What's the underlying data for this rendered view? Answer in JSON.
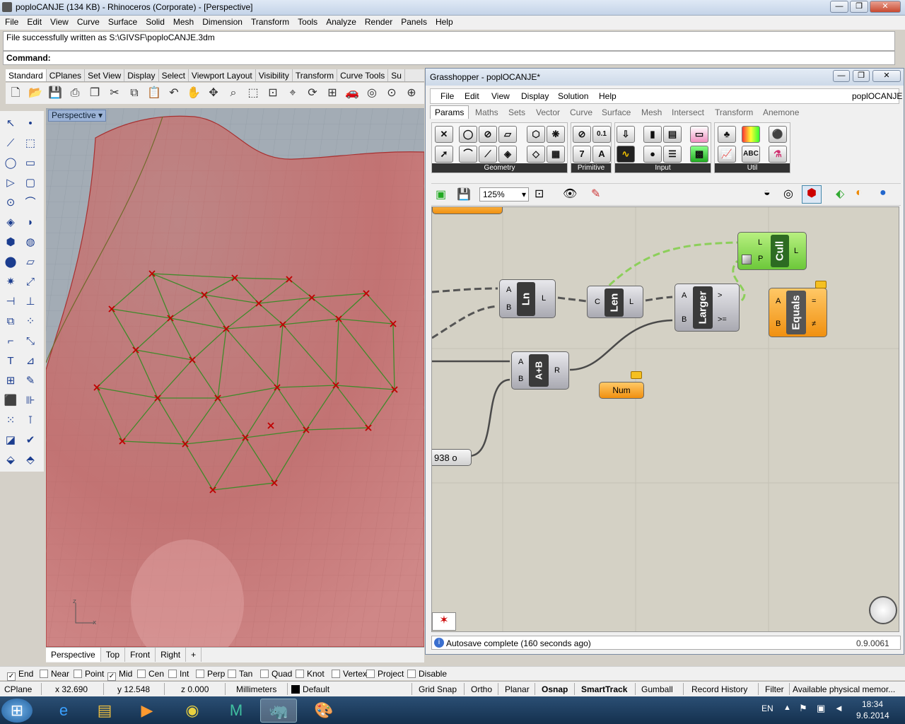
{
  "window": {
    "title": "poploCANJE (134 KB) - Rhinoceros (Corporate) - [Perspective]",
    "min": "—",
    "max": "❐",
    "close": "✕"
  },
  "menu": [
    "File",
    "Edit",
    "View",
    "Curve",
    "Surface",
    "Solid",
    "Mesh",
    "Dimension",
    "Transform",
    "Tools",
    "Analyze",
    "Render",
    "Panels",
    "Help"
  ],
  "command": {
    "history": "File successfully written as S:\\GIVSF\\poploCANJE.3dm",
    "prompt": "Command:"
  },
  "toolbar_tabs": [
    "Standard",
    "CPlanes",
    "Set View",
    "Display",
    "Select",
    "Viewport Layout",
    "Visibility",
    "Transform",
    "Curve Tools",
    "Su"
  ],
  "viewport": {
    "title": "Perspective",
    "tabs": [
      "Perspective",
      "Top",
      "Front",
      "Right",
      "+"
    ]
  },
  "osnap": [
    {
      "label": "End",
      "checked": true
    },
    {
      "label": "Near",
      "checked": false
    },
    {
      "label": "Point",
      "checked": false
    },
    {
      "label": "Mid",
      "checked": true
    },
    {
      "label": "Cen",
      "checked": false
    },
    {
      "label": "Int",
      "checked": false
    },
    {
      "label": "Perp",
      "checked": false
    },
    {
      "label": "Tan",
      "checked": false
    },
    {
      "label": "Quad",
      "checked": false
    },
    {
      "label": "Knot",
      "checked": false
    },
    {
      "label": "Vertex",
      "checked": false
    },
    {
      "label": "Project",
      "checked": false
    },
    {
      "label": "Disable",
      "checked": false
    }
  ],
  "status": {
    "cplane": "CPlane",
    "x": "x 32.690",
    "y": "y 12.548",
    "z": "z 0.000",
    "units": "Millimeters",
    "layer": "Default",
    "toggles": [
      "Grid Snap",
      "Ortho",
      "Planar",
      "Osnap",
      "SmartTrack",
      "Gumball",
      "Record History",
      "Filter"
    ],
    "memory": "Available physical memor..."
  },
  "taskbar": {
    "lang": "EN",
    "time": "18:34",
    "date": "9.6.2014"
  },
  "grasshopper": {
    "title": "Grasshopper - poplOCANJE*",
    "doc": "poplOCANJE",
    "menu": [
      "File",
      "Edit",
      "View",
      "Display",
      "Solution",
      "Help"
    ],
    "tabs": [
      "Params",
      "Maths",
      "Sets",
      "Vector",
      "Curve",
      "Surface",
      "Mesh",
      "Intersect",
      "Transform",
      "Anemone"
    ],
    "groups": [
      "Geometry",
      "Primitive",
      "Input",
      "Util"
    ],
    "zoom": "125%",
    "components": {
      "ln": {
        "label": "Ln",
        "inputs": [
          "A",
          "B"
        ],
        "outputs": [
          "L"
        ]
      },
      "len": {
        "label": "Len",
        "inputs": [
          "C"
        ],
        "outputs": [
          "L"
        ]
      },
      "larger": {
        "label": "Larger",
        "inputs": [
          "A",
          "B"
        ],
        "outputs": [
          ">",
          ">="
        ]
      },
      "cull": {
        "label": "Cull",
        "inputs": [
          "L",
          "P"
        ],
        "outputs": [
          "L"
        ]
      },
      "equals": {
        "label": "Equals",
        "inputs": [
          "A",
          "B"
        ],
        "outputs": [
          "=",
          "≠"
        ]
      },
      "add": {
        "label": "A+B",
        "inputs": [
          "A",
          "B"
        ],
        "outputs": [
          "R"
        ]
      },
      "num": {
        "label": "Num"
      },
      "slider": {
        "value": "938"
      }
    },
    "status": "Autosave complete (160 seconds ago)",
    "version": "0.9.0061"
  },
  "colors": {
    "surface": "#c98080",
    "mesh_line": "#3f8a2a",
    "point": "#c00000",
    "gh_canvas": "#d4d1c5",
    "cull_green": "#8ee05a",
    "orange": "#f5a623"
  }
}
